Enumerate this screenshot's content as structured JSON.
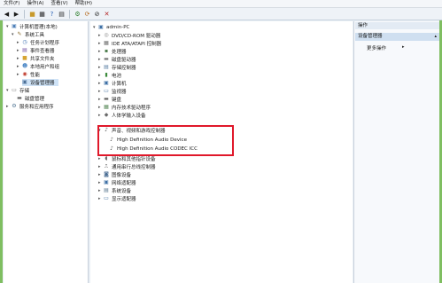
{
  "menu": {
    "items": [
      "文件(F)",
      "操作(A)",
      "查看(V)",
      "帮助(H)"
    ]
  },
  "left_tree": [
    {
      "label": "计算机管理(本地)",
      "icon": "computer-mgmt-icon"
    },
    {
      "label": "系统工具",
      "icon": "tools-icon"
    },
    {
      "label": "任务计划程序",
      "icon": "clock-icon"
    },
    {
      "label": "事件查看器",
      "icon": "event-icon"
    },
    {
      "label": "共享文件夹",
      "icon": "folder-icon"
    },
    {
      "label": "本地用户和组",
      "icon": "users-icon"
    },
    {
      "label": "性能",
      "icon": "perf-icon"
    },
    {
      "label": "设备管理器",
      "icon": "device-icon"
    },
    {
      "label": "存储",
      "icon": "storage-icon"
    },
    {
      "label": "磁盘管理",
      "icon": "disk-icon"
    },
    {
      "label": "服务和应用程序",
      "icon": "services-icon"
    }
  ],
  "device_tree": [
    {
      "label": "admin-PC",
      "icon": "computer-icon"
    },
    {
      "label": "DVD/CD-ROM 驱动器",
      "icon": "dvd-icon"
    },
    {
      "label": "IDE ATA/ATAPI 控制器",
      "icon": "ide-icon"
    },
    {
      "label": "处理器",
      "icon": "cpu-icon"
    },
    {
      "label": "磁盘驱动器",
      "icon": "disk-icon"
    },
    {
      "label": "存储控制器",
      "icon": "storage-icon"
    },
    {
      "label": "电池",
      "icon": "battery-icon"
    },
    {
      "label": "计算机",
      "icon": "computer-icon"
    },
    {
      "label": "监视器",
      "icon": "monitor-icon"
    },
    {
      "label": "键盘",
      "icon": "keyboard-icon"
    },
    {
      "label": "内存技术驱动程序",
      "icon": "memory-icon"
    },
    {
      "label": "人体学输入设备",
      "icon": "hid-icon"
    },
    {
      "label": "声音、视频和游戏控制器",
      "icon": "sound-icon"
    },
    {
      "label": "High Definition Audio Device",
      "icon": "audio-icon"
    },
    {
      "label": "High Definition Audio CODEC ICC",
      "icon": "audio-icon"
    },
    {
      "label": "鼠标和其他指针设备",
      "icon": "mouse-icon"
    },
    {
      "label": "通用串行总线控制器",
      "icon": "usb-icon"
    },
    {
      "label": "图像设备",
      "icon": "camera-icon"
    },
    {
      "label": "网络适配器",
      "icon": "network-icon"
    },
    {
      "label": "系统设备",
      "icon": "system-icon"
    },
    {
      "label": "显示适配器",
      "icon": "display-icon"
    }
  ],
  "actions": {
    "header": "操作",
    "section": "设备管理器",
    "more": "更多操作"
  }
}
